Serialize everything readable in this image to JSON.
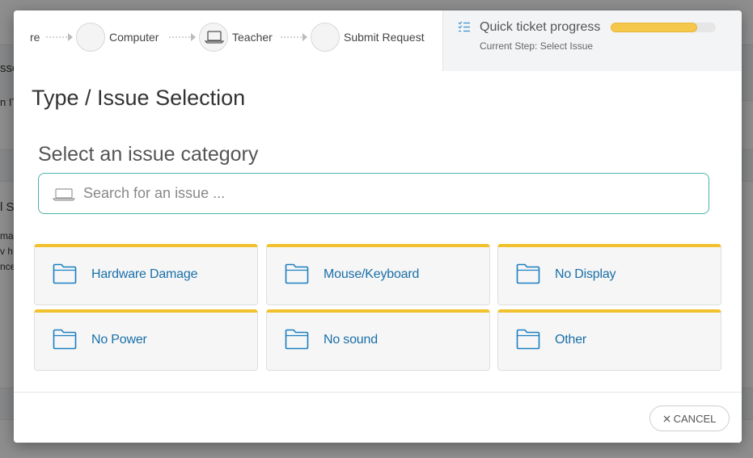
{
  "background": {
    "fragments": [
      "ssc",
      "n IT",
      "l Se",
      "ma",
      "v h",
      "nce"
    ]
  },
  "steps": [
    {
      "label": "re"
    },
    {
      "label": "Computer"
    },
    {
      "label": "Teacher"
    },
    {
      "label": "Submit Request"
    }
  ],
  "progress": {
    "title": "Quick ticket progress",
    "current_step": "Current Step:  Select Issue",
    "fraction": 0.82,
    "color": "#f5c84c"
  },
  "page_title": "Type / Issue Selection",
  "section_title": "Select an issue category",
  "search": {
    "placeholder": "Search for an issue ...",
    "value": ""
  },
  "categories": [
    {
      "label": "Hardware Damage"
    },
    {
      "label": "Mouse/Keyboard"
    },
    {
      "label": "No Display"
    },
    {
      "label": "No Power"
    },
    {
      "label": "No sound"
    },
    {
      "label": "Other"
    }
  ],
  "footer": {
    "cancel_label": "CANCEL"
  },
  "colors": {
    "accent": "#4db3a6",
    "tile_border": "#f2c12e",
    "link": "#1a6fa8"
  }
}
